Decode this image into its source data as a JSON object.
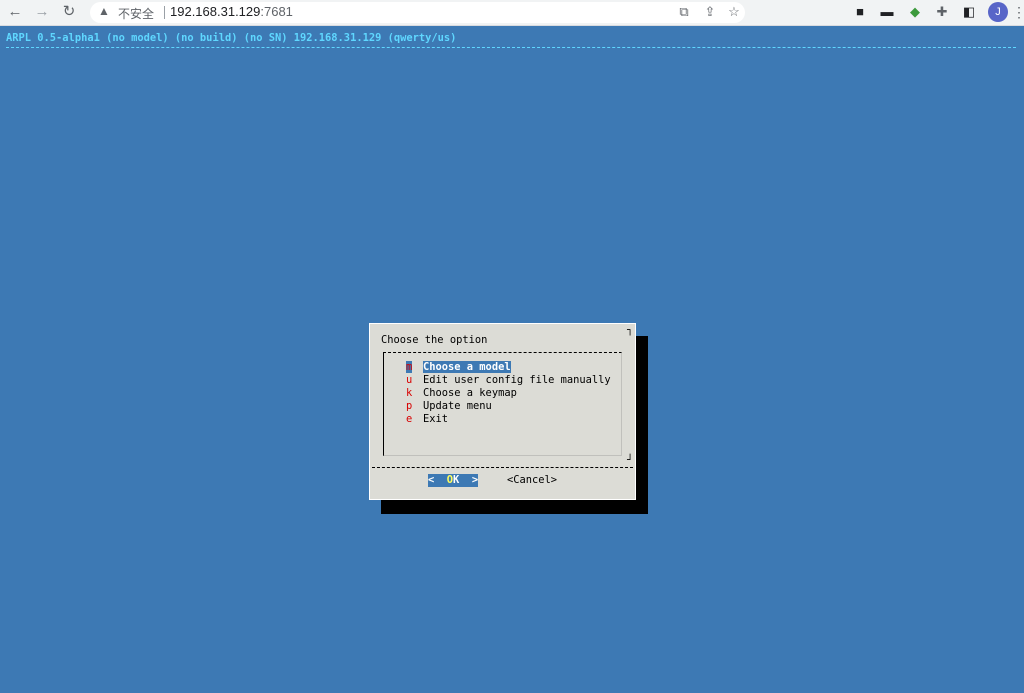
{
  "browser": {
    "back_icon": "←",
    "forward_icon": "→",
    "reload_icon": "↻",
    "security_warning": "不安全",
    "url_host": "192.168.31.129",
    "url_port": ":7681",
    "avatar_initial": "J"
  },
  "terminal": {
    "backtitle": "ARPL 0.5-alpha1 (no model) (no build) (no SN) 192.168.31.129 (qwerty/us)",
    "dialog": {
      "title": "Choose the option",
      "items": [
        {
          "tag": "m",
          "label": "Choose a model"
        },
        {
          "tag": "u",
          "label": "Edit user config file manually"
        },
        {
          "tag": "k",
          "label": "Choose a keymap"
        },
        {
          "tag": "p",
          "label": "Update menu"
        },
        {
          "tag": "e",
          "label": "Exit"
        }
      ],
      "selected_index": 0,
      "ok_prefix": "<  ",
      "ok_hot": "O",
      "ok_rest": "K  >",
      "cancel_label": "<Cancel>"
    }
  },
  "colors": {
    "terminal_bg": "#3d79b4",
    "backtitle": "#5fd7ff",
    "dialog_bg": "#dcdcd6",
    "hotkey_red": "#d70000",
    "hotkey_yellow": "#ffff5f"
  }
}
